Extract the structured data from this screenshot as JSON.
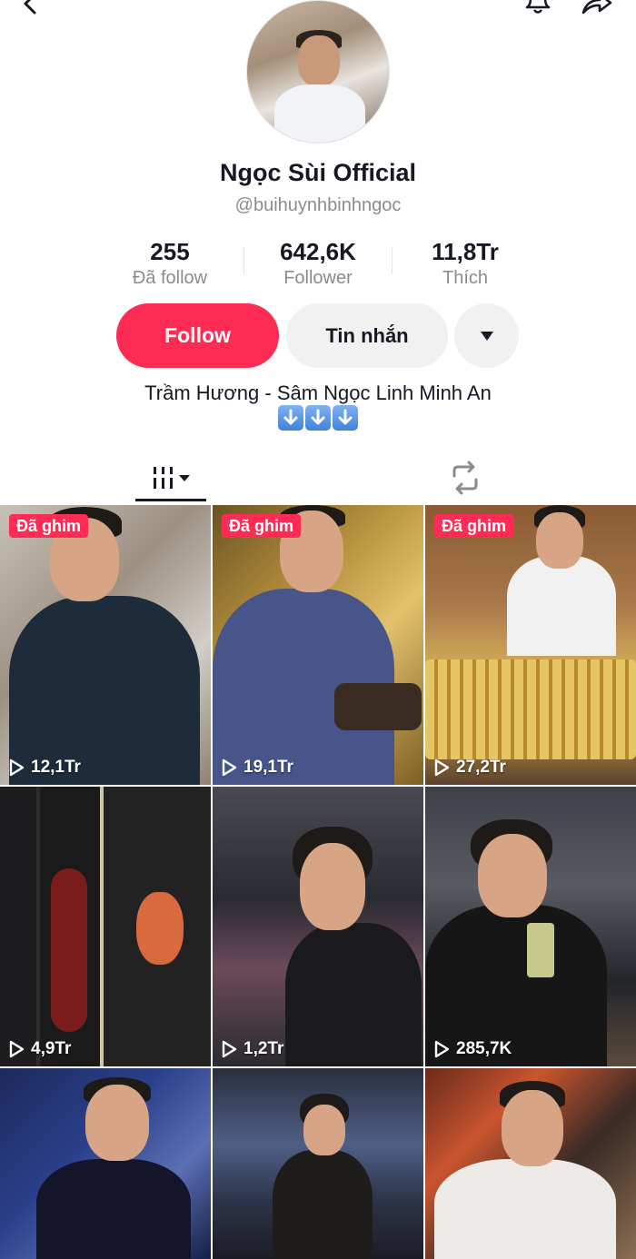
{
  "profile": {
    "display_name": "Ngọc Sùi Official",
    "username": "@buihuynhbinhngoc",
    "bio_line1": "Trầm Hương - Sâm Ngọc Linh Minh An",
    "bio_emoji": "⬇️⬇️⬇️"
  },
  "stats": [
    {
      "value": "255",
      "label": "Đã follow"
    },
    {
      "value": "642,6K",
      "label": "Follower"
    },
    {
      "value": "11,8Tr",
      "label": "Thích"
    }
  ],
  "actions": {
    "follow_label": "Follow",
    "message_label": "Tin nhắn"
  },
  "icons": {
    "back": "chevron-left-icon",
    "bell": "bell-icon",
    "share": "share-arrow-icon",
    "more": "caret-down-icon",
    "videos_tab": "grid-columns-icon",
    "repost_tab": "repost-icon",
    "play": "play-outline-icon"
  },
  "colors": {
    "accent": "#fe2c55",
    "secondary_button": "#f1f1f2",
    "muted_text": "#8a8b91"
  },
  "videos": [
    {
      "pinned_label": "Đã ghim",
      "views": "12,1Tr"
    },
    {
      "pinned_label": "Đã ghim",
      "views": "19,1Tr"
    },
    {
      "pinned_label": "Đã ghim",
      "views": "27,2Tr"
    },
    {
      "pinned_label": "",
      "views": "4,9Tr"
    },
    {
      "pinned_label": "",
      "views": "1,2Tr"
    },
    {
      "pinned_label": "",
      "views": "285,7K"
    },
    {
      "pinned_label": "",
      "views": ""
    },
    {
      "pinned_label": "",
      "views": ""
    },
    {
      "pinned_label": "",
      "views": ""
    }
  ]
}
